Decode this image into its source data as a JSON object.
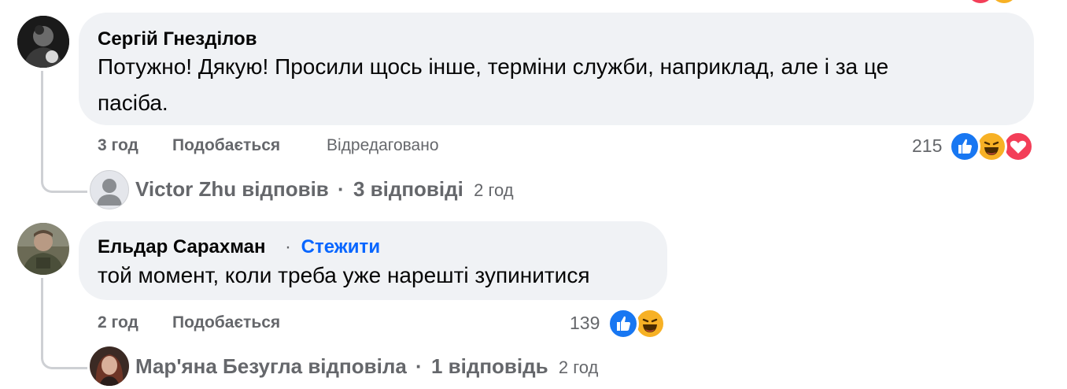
{
  "comments": [
    {
      "author": "Сергій Гнездiлов",
      "text_line1": "Потужно! Дякую! Просили щось інше, терміни служби, наприклад, але і за це",
      "text_line2": "пасіба.",
      "time": "3 год",
      "like": "Подобається",
      "edited": "Відредаговано",
      "reaction_count": "215",
      "reactions": [
        "like-icon",
        "haha-icon",
        "love-icon"
      ],
      "reply_summary": {
        "name": "Victor Zhu відповів",
        "sep": "·",
        "replies": "3 відповіді",
        "time": "2 год"
      }
    },
    {
      "author": "Ельдар Сарахман",
      "follow_sep": "·",
      "follow": "Стежити",
      "text_line1": "той момент, коли треба уже нарешті зупинитися",
      "time": "2 год",
      "like": "Подобається",
      "reaction_count": "139",
      "reactions": [
        "like-icon",
        "haha-icon"
      ],
      "reply_summary": {
        "name": "Мар'яна Безугла відповіла",
        "sep": "·",
        "replies": "1 відповідь",
        "time": "2 год"
      }
    }
  ],
  "colors": {
    "like_blue": "#1877f2",
    "haha_yellow": "#f7b125",
    "love_red": "#f33e58",
    "follow_blue": "#0866ff",
    "bubble_bg": "#f0f2f5",
    "meta_gray": "#65676b"
  }
}
